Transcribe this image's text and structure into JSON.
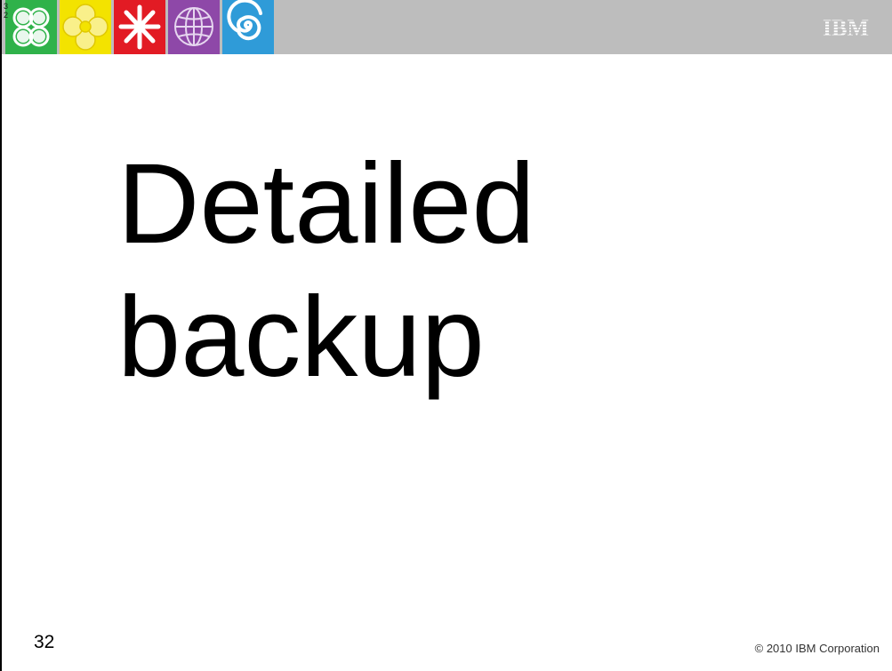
{
  "header": {
    "corner_digits": "3\n2",
    "tiles": [
      {
        "icon": "clover-icon",
        "color": "#2fb24a"
      },
      {
        "icon": "flower-icon",
        "color": "#f3e300"
      },
      {
        "icon": "asterisk-icon",
        "color": "#e21b24"
      },
      {
        "icon": "globe-icon",
        "color": "#8e48a8"
      },
      {
        "icon": "spiral-icon",
        "color": "#2f9bd8"
      }
    ],
    "logo_text": "IBM",
    "bar_color": "#bdbdbd"
  },
  "slide": {
    "title": "Detailed\nbackup"
  },
  "footer": {
    "page_number": "32",
    "copyright": "© 2010 IBM Corporation"
  }
}
